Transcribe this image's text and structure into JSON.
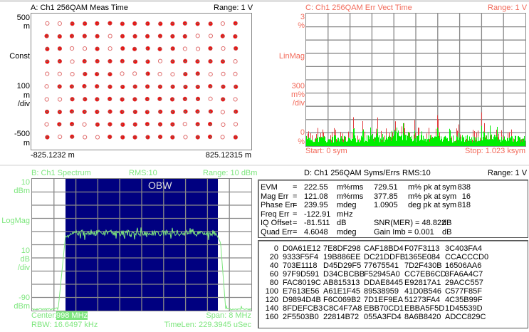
{
  "panel_a": {
    "title": "A: Ch1 256QAM Meas Time",
    "range": "Range: 1  V",
    "y_top": "500",
    "y_top_unit": "m",
    "format": "Const",
    "scale": "100",
    "scale_unit": "m",
    "scale_per": "/div",
    "y_bottom": "-500",
    "y_bottom_unit": "m",
    "x_start": "-825.1232 m",
    "x_stop": "825.12315 m",
    "colors": {
      "points": "#ff0000"
    }
  },
  "panel_c": {
    "title": "C: Ch1 256QAM Err Vect Time",
    "range": "Range: 1  V",
    "y_top": "3",
    "y_top_unit": "%",
    "format": "LinMag",
    "scale": "300",
    "scale_unit": "m%",
    "scale_per": "/div",
    "y_bottom": "0",
    "y_bottom_unit": "%",
    "start": "Start: 0  sym",
    "stop": "Stop: 1.023 ksym",
    "colors": {
      "label": "#f26a5a",
      "trace": "#00ee00"
    }
  },
  "panel_b": {
    "title": "B: Ch1 Spectrum",
    "rms": "RMS:10",
    "range": "Range: 10 dBm",
    "y_top": "10",
    "y_top_unit": "dBm",
    "format": "LogMag",
    "scale": "10",
    "scale_unit": "dB",
    "scale_per": "/div",
    "y_bottom": "-90",
    "y_bottom_unit": "dBm",
    "obw_label": "OBW",
    "center_label": "Center:",
    "center_value": "998 MHz",
    "span": "Span: 8 MHz",
    "rbw": "RBW: 16.6497 kHz",
    "timelen": "TimeLen: 229.3945 uSec",
    "colors": {
      "label": "#7ee67e",
      "obw_fill": "#000080"
    }
  },
  "panel_d": {
    "title": "D: Ch1 256QAM Syms/Errs",
    "rms": "RMS:10",
    "range": "Range: 1  V",
    "metrics": [
      [
        "EVM",
        "=",
        "222.55",
        "m%rms",
        "729.51",
        "m% pk  at",
        "sym",
        "838"
      ],
      [
        "Mag Err",
        "=",
        "121.08",
        "m%rms",
        "377.85",
        "m% pk  at",
        "sym",
        "16"
      ],
      [
        "Phase Err",
        "=",
        "239.95",
        "mdeg",
        "1.0905",
        "deg pk  at",
        "sym",
        "818"
      ],
      [
        "Freq Err",
        "=",
        "-122.91",
        "mHz",
        "",
        "",
        "",
        ""
      ],
      [
        "IQ Offset",
        "=",
        "-81.511",
        "dB",
        "SNR(MER)  =  48.822",
        "",
        "dB",
        ""
      ],
      [
        "Quad Err",
        "=",
        "4.6048",
        "mdeg",
        "Gain  Imb   =  0.001",
        "",
        "dB",
        ""
      ]
    ],
    "symbols": [
      [
        "0",
        "D0A61E12",
        "7E8DF298",
        "CAF18BD4",
        "F07F3113",
        "3C403FA4"
      ],
      [
        "20",
        "9333F5F4",
        "19B886EE",
        "DC21DDFB",
        "1365E084",
        "CCACCCD0"
      ],
      [
        "40",
        "703E1118",
        "D45D29F5",
        "77675541",
        "7D2F430B",
        "16506AA6"
      ],
      [
        "60",
        "97F9D591",
        "D34CBCBB",
        "F52945A0",
        "CC7EB6CD",
        "3FA6A4C7"
      ],
      [
        "80",
        "FAC8019C",
        "AB815313",
        "DDAE8445",
        "E92817A1",
        "29ACC557"
      ],
      [
        "100",
        "E7613E56",
        "A61E1F45",
        "89538959",
        "41D0B546",
        "C577F85F"
      ],
      [
        "120",
        "D9894D4B",
        "F6C069B2",
        "7D1EF9EA",
        "51273FA4",
        "4C35B99F"
      ],
      [
        "140",
        "8FDEFCB3",
        "C8C4F7A8",
        "EBB70CD1",
        "EBBA5F5D",
        "1D45539D"
      ],
      [
        "160",
        "2F5503B0",
        "22814B72",
        "055A3FD4",
        "8A6B8420",
        "ADCC829C"
      ]
    ]
  }
}
